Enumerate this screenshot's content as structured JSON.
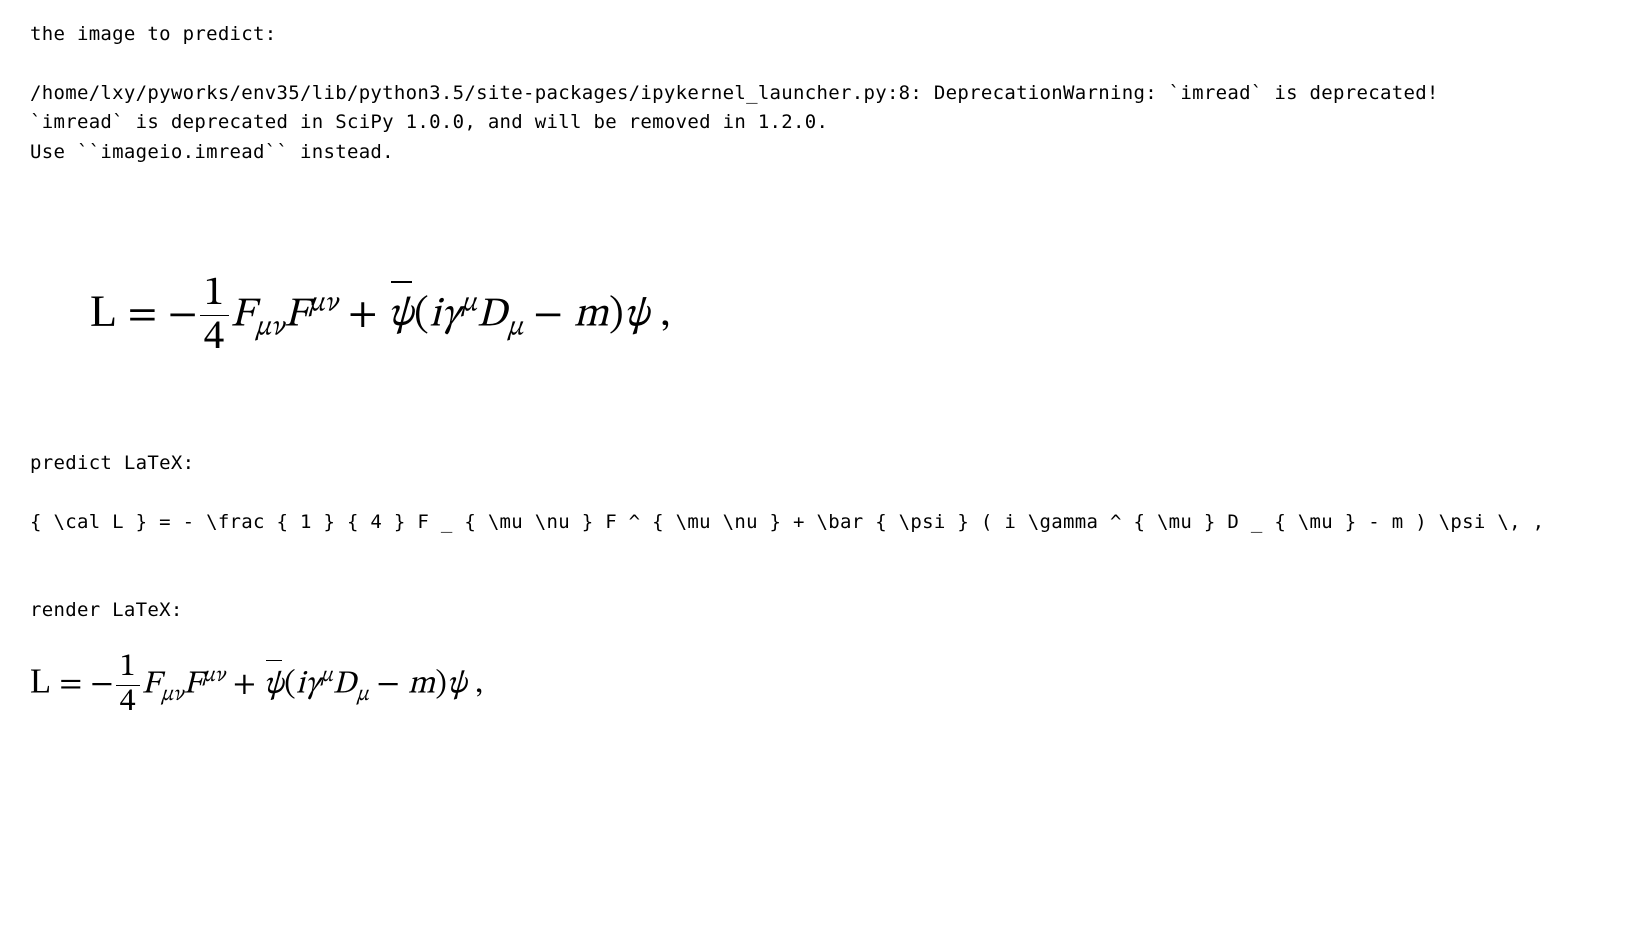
{
  "header_label": "the image to predict:",
  "warning_line1": "/home/lxy/pyworks/env35/lib/python3.5/site-packages/ipykernel_launcher.py:8: DeprecationWarning: `imread` is deprecated!",
  "warning_line2": "`imread` is deprecated in SciPy 1.0.0, and will be removed in 1.2.0.",
  "warning_line3": "Use ``imageio.imread`` instead.",
  "predict_label": "predict LaTeX:",
  "latex_source": "{ \\cal L } = - \\frac { 1 } { 4 } F _ { \\mu \\nu } F ^ { \\mu \\nu } + \\bar { \\psi } ( i \\gamma ^ { \\mu } D _ { \\mu } - m ) \\psi \\, ,",
  "render_label": "render LaTeX:",
  "formula": {
    "cal_L": "L",
    "equals": " = ",
    "minus": "−",
    "frac_num": "1",
    "frac_den": "4",
    "F1": "F",
    "sub_munu": "μν",
    "F2": "F",
    "sup_munu": "μν",
    "plus": " + ",
    "psi_bar": "ψ",
    "lparen": "(",
    "i": "i",
    "gamma": "γ",
    "sup_mu": "μ",
    "D": "D",
    "sub_mu": "μ",
    "minus2": " − ",
    "m": "m",
    "rparen": ")",
    "psi": "ψ",
    "comma": " ,"
  }
}
